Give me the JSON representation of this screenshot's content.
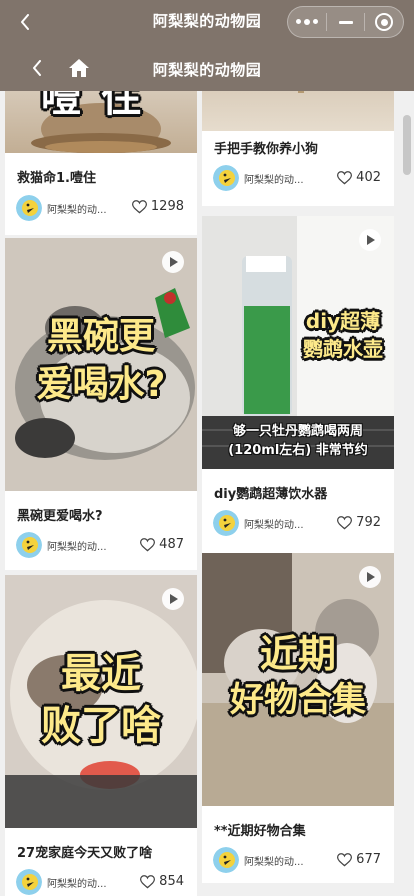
{
  "app": {
    "title": "阿梨梨的动物园",
    "page_title": "阿梨梨的动物园",
    "colors": {
      "topbar": "#80746b",
      "card_bg": "#ffffff",
      "feed_bg": "#f0f0f0",
      "overlay_text": "#fde98a"
    }
  },
  "cards": [
    {
      "title": "救猫命1.噎住",
      "author": "阿梨梨的动...",
      "likes": "1298",
      "overlay": "噎住"
    },
    {
      "title": "手把手教你养小狗",
      "author": "阿梨梨的动...",
      "likes": "402"
    },
    {
      "title": "黑碗更爱喝水?",
      "author": "阿梨梨的动...",
      "likes": "487",
      "overlay_line1": "黑碗更",
      "overlay_line2": "爱喝水?"
    },
    {
      "title": "diy鹦鹉超薄饮水器",
      "author": "阿梨梨的动...",
      "likes": "792",
      "overlay_line1": "diy超薄",
      "overlay_line2": "鹦鹉水壶",
      "caption_line1": "够一只牡丹鹦鹉喝两周",
      "caption_line2": "(120ml左右) 非常节约"
    },
    {
      "title": "27宠家庭今天又败了啥",
      "author": "阿梨梨的动...",
      "likes": "854",
      "overlay_line1": "最近",
      "overlay_line2": "败了啥"
    },
    {
      "title": "**近期好物合集",
      "author": "阿梨梨的动...",
      "likes": "677",
      "overlay_line1": "近期",
      "overlay_line2": "好物合集"
    }
  ]
}
